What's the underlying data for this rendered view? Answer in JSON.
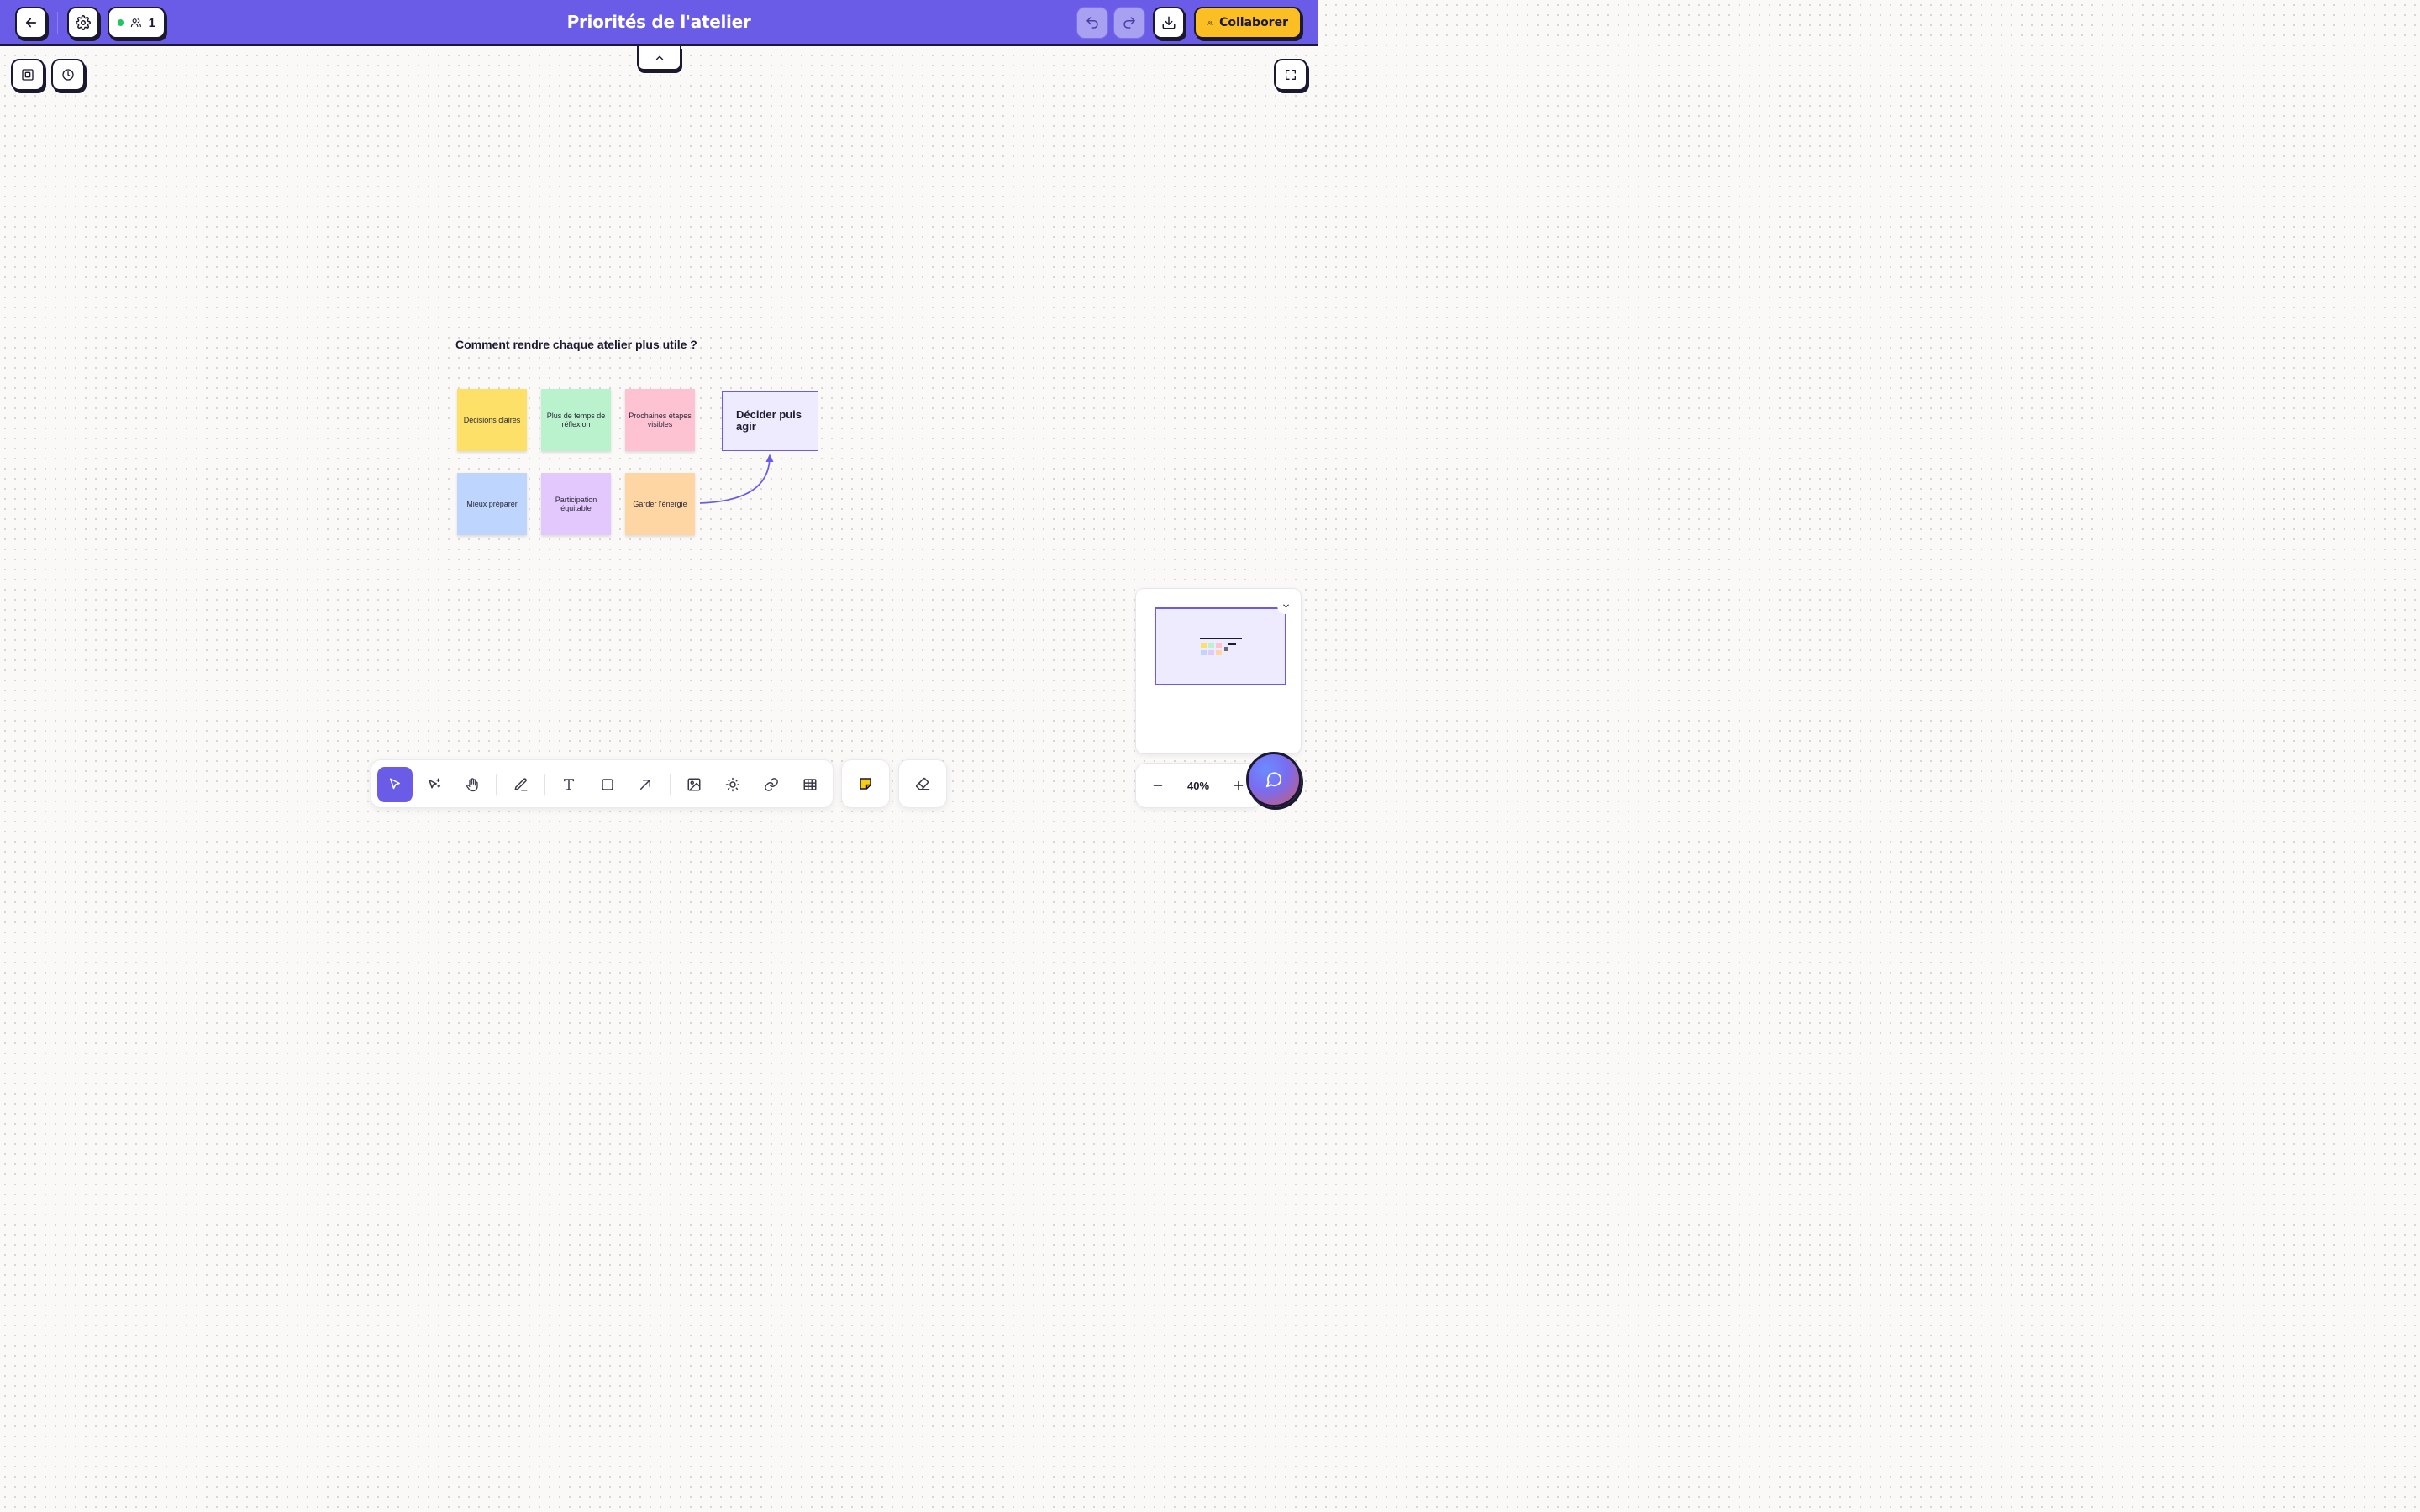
{
  "header": {
    "title": "Priorités de l'atelier",
    "presence_count": "1",
    "collaborate_label": "Collaborer",
    "accent_color": "#6b5ce7"
  },
  "board": {
    "question": "Comment rendre chaque atelier plus utile ?",
    "stickies": [
      {
        "label": "Décisions claires",
        "color": "#fde068"
      },
      {
        "label": "Plus de temps de réflexion",
        "color": "#b9f2cc"
      },
      {
        "label": "Prochaines étapes visibles",
        "color": "#fec3d3"
      },
      {
        "label": "Mieux préparer",
        "color": "#bed6fe"
      },
      {
        "label": "Participation équitable",
        "color": "#e3c8fe"
      },
      {
        "label": "Garder l'énergie",
        "color": "#fdd6a4"
      }
    ],
    "decision_box": "Décider puis agir"
  },
  "zoom": {
    "level": "40%"
  },
  "icons": {
    "back": "arrow-left-icon",
    "settings": "gear-icon",
    "users": "users-icon",
    "undo": "undo-icon",
    "redo": "redo-icon",
    "download": "download-icon",
    "frame": "frame-icon",
    "history": "clock-icon",
    "fullscreen": "expand-icon",
    "collapse": "chevron-up-icon",
    "select": "cursor-icon",
    "magic_select": "magic-cursor-icon",
    "hand": "hand-icon",
    "pen": "pen-icon",
    "text": "text-icon",
    "shape": "square-icon",
    "arrow": "arrow-icon",
    "image": "image-icon",
    "ai": "sparkle-icon",
    "link": "link-icon",
    "table": "table-icon",
    "sticky": "sticky-note-icon",
    "eraser": "eraser-icon",
    "chat": "chat-icon"
  }
}
